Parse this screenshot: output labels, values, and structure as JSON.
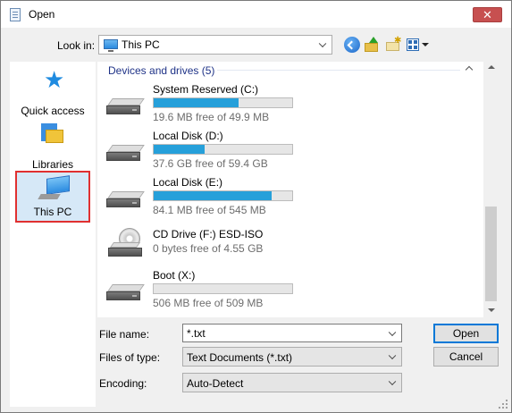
{
  "window": {
    "title": "Open",
    "close_symbol": "✕"
  },
  "toolbar": {
    "look_in_label": "Look in:",
    "look_in_value": "This PC",
    "icons": [
      "back-icon",
      "up-folder-icon",
      "new-folder-icon",
      "view-menu-icon"
    ]
  },
  "places": [
    {
      "label": "Quick access",
      "icon": "star-icon"
    },
    {
      "label": "Libraries",
      "icon": "libraries-icon"
    },
    {
      "label": "This PC",
      "icon": "computer-icon",
      "selected": true
    }
  ],
  "list": {
    "group_header": "Devices and drives (5)",
    "drives": [
      {
        "name": "System Reserved (C:)",
        "free_text": "19.6 MB free of 49.9 MB",
        "used_fraction": 0.61,
        "icon": "hard-drive-icon"
      },
      {
        "name": "Local Disk (D:)",
        "free_text": "37.6 GB free of 59.4 GB",
        "used_fraction": 0.37,
        "icon": "hard-drive-icon"
      },
      {
        "name": "Local Disk (E:)",
        "free_text": "84.1 MB free of 545 MB",
        "used_fraction": 0.85,
        "icon": "hard-drive-icon"
      },
      {
        "name": "CD Drive (F:) ESD-ISO",
        "free_text": "0 bytes free of 4.55 GB",
        "icon": "cd-drive-icon"
      },
      {
        "name": "Boot (X:)",
        "free_text": "506 MB free of 509 MB",
        "used_fraction": 0.0,
        "icon": "hard-drive-icon"
      }
    ]
  },
  "fields": {
    "file_name_label": "File name:",
    "file_name_value": "*.txt",
    "file_type_label": "Files of type:",
    "file_type_value": "Text Documents (*.txt)",
    "encoding_label": "Encoding:",
    "encoding_value": "Auto-Detect"
  },
  "buttons": {
    "open": "Open",
    "cancel": "Cancel"
  },
  "colors": {
    "progress": "#26a0da",
    "selection_outline": "#e03030",
    "group_header": "#1e3287"
  }
}
